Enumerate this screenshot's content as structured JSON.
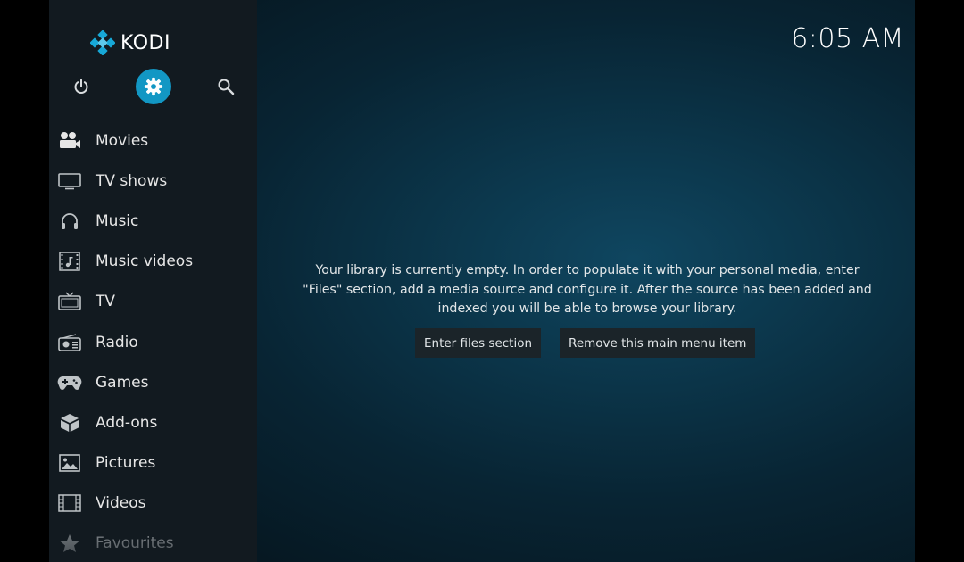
{
  "app": {
    "logo_text": "KODI",
    "clock": "6:05 AM"
  },
  "top_buttons": [
    {
      "name": "power",
      "icon": "power-icon"
    },
    {
      "name": "settings",
      "icon": "gear-icon",
      "active": true
    },
    {
      "name": "search",
      "icon": "search-icon"
    }
  ],
  "menu": {
    "items": [
      {
        "label": "Movies",
        "icon": "movie-camera-icon"
      },
      {
        "label": "TV shows",
        "icon": "monitor-icon"
      },
      {
        "label": "Music",
        "icon": "headphones-icon"
      },
      {
        "label": "Music videos",
        "icon": "music-video-icon"
      },
      {
        "label": "TV",
        "icon": "tv-icon"
      },
      {
        "label": "Radio",
        "icon": "radio-icon"
      },
      {
        "label": "Games",
        "icon": "gamepad-icon"
      },
      {
        "label": "Add-ons",
        "icon": "addons-box-icon"
      },
      {
        "label": "Pictures",
        "icon": "picture-icon"
      },
      {
        "label": "Videos",
        "icon": "film-strip-icon"
      },
      {
        "label": "Favourites",
        "icon": "star-icon"
      }
    ]
  },
  "main": {
    "message_line1": "Your library is currently empty. In order to populate it with your personal media, enter",
    "message_line2": "\"Files\" section, add a media source and configure it. After the source has been added and",
    "message_line3": "indexed you will be able to browse your library.",
    "enter_files_label": "Enter files section",
    "remove_item_label": "Remove this main menu item"
  },
  "colors": {
    "accent": "#1297c4",
    "sidebar_bg": "#121a20",
    "button_bg": "#1b2429"
  }
}
